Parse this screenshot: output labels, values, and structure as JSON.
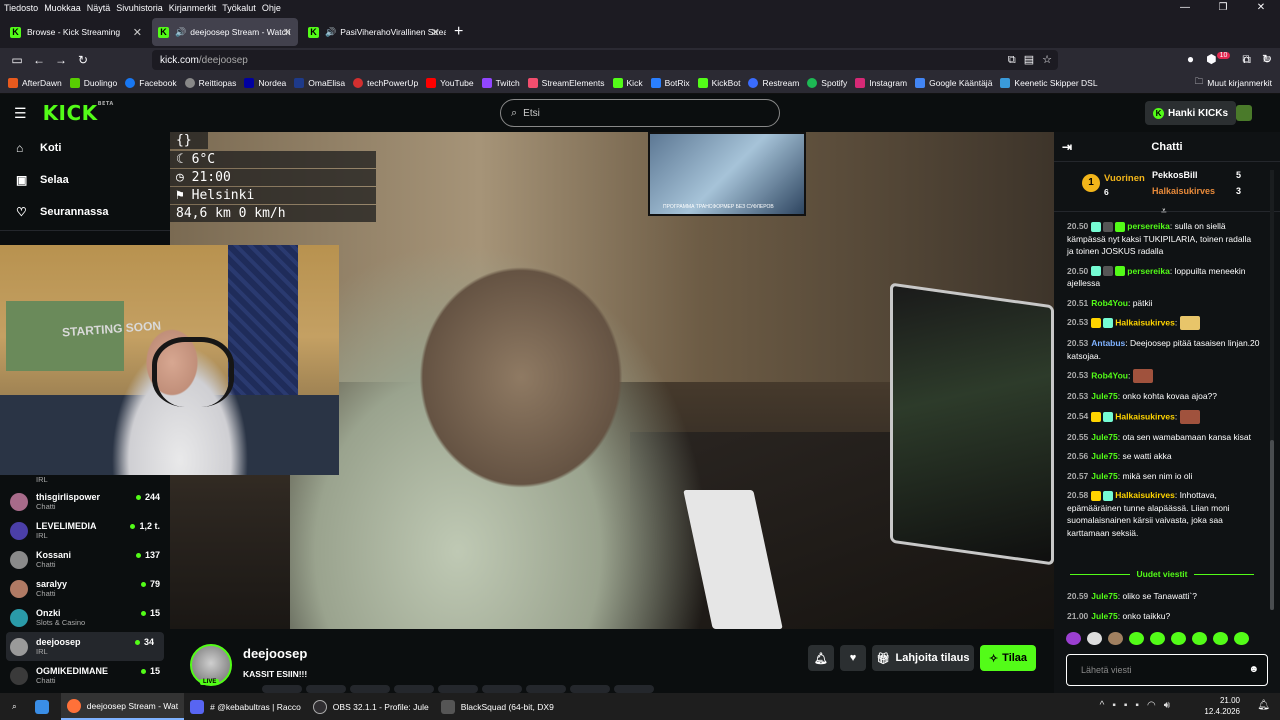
{
  "menubar": [
    "Tiedosto",
    "Muokkaa",
    "Näytä",
    "Sivuhistoria",
    "Kirjanmerkit",
    "Työkalut",
    "Ohje"
  ],
  "tabs": [
    {
      "label": "Browse - Kick Streaming"
    },
    {
      "label": "deejoosep Stream - Watch"
    },
    {
      "label": "PasiViherahoVirallinen Strea"
    }
  ],
  "url": {
    "host": "kick.com",
    "path": "/deejoosep"
  },
  "extension_badge": "10",
  "bookmarks": [
    "AfterDawn",
    "Duolingo",
    "Facebook",
    "Reittiopas",
    "Nordea",
    "OmaElisa",
    "techPowerUp",
    "YouTube",
    "Twitch",
    "StreamElements",
    "Kick",
    "BotRix",
    "KickBot",
    "Restream",
    "Spotify",
    "Instagram",
    "Google Kääntäjä",
    "Keenetic Skipper DSL"
  ],
  "bookmarks_other": "Muut kirjanmerkit",
  "kick": {
    "logo": "KICK",
    "logo_beta": "BETA",
    "search_placeholder": "Etsi",
    "kicks_button": "Hanki KICKs"
  },
  "sidebar": {
    "nav": [
      "Koti",
      "Selaa",
      "Seurannassa"
    ],
    "partial_category": "IRL",
    "channels": [
      {
        "name": "thisgirlispower",
        "category": "Chatti",
        "viewers": "244",
        "color": "#a86b8a"
      },
      {
        "name": "LEVELIMEDIA",
        "category": "IRL",
        "viewers": "1,2 t.",
        "color": "#4b3fa8"
      },
      {
        "name": "Kossani",
        "category": "Chatti",
        "viewers": "137",
        "color": "#8a8a8a"
      },
      {
        "name": "saralyy",
        "category": "Chatti",
        "viewers": "79",
        "color": "#b07a64"
      },
      {
        "name": "Onzki",
        "category": "Slots & Casino",
        "viewers": "15",
        "color": "#2a9aa8"
      },
      {
        "name": "deejoosep",
        "category": "IRL",
        "viewers": "34",
        "color": "#9a9a9a"
      },
      {
        "name": "OGMIKEDIMANE",
        "category": "Chatti",
        "viewers": "15",
        "color": "#3a3a3a"
      }
    ]
  },
  "overlay": {
    "braces": "{}",
    "weather": "6°C",
    "time": "21:00",
    "city": "Helsinki",
    "speed": "84,6 km  0 km/h"
  },
  "webcam_poster": "STARTING SOON",
  "tv_caption": "ПРОГРАММА ТРАНСФОРМЕР БЕЗ СУФЛЕРОВ",
  "stream": {
    "channel": "deejoosep",
    "title": "KASSIT ESIIN!!!",
    "live": "LIVE",
    "gift_label": "Lahjoita tilaus",
    "subscribe_label": "Tilaa"
  },
  "chat": {
    "title": "Chatti",
    "leaderboard": {
      "title": "Vuorinen",
      "rank": "1",
      "first_count": "6",
      "entries": [
        {
          "name": "PekkosBill",
          "count": "5"
        },
        {
          "name": "Halkaisukirves",
          "count": "3"
        }
      ]
    },
    "messages": [
      {
        "time": "20.50",
        "user": "persereika",
        "color": "green",
        "text": "sulla on siellä kämpässä nyt kaksi TUKIPILARIA, toinen radalla ja toinen JOSKUS radalla"
      },
      {
        "time": "20.50",
        "user": "persereika",
        "color": "green",
        "text": "loppuilta meneekin ajellessa"
      },
      {
        "time": "20.51",
        "user": "Rob4You",
        "color": "green",
        "text": "pätkii"
      },
      {
        "time": "20.53",
        "user": "Halkaisukirves",
        "color": "yel",
        "text": ""
      },
      {
        "time": "20.53",
        "user": "Antabus",
        "color": "blue",
        "text": "Deejoosep pitää tasaisen linjan.20 katsojaa."
      },
      {
        "time": "20.53",
        "user": "Rob4You",
        "color": "green",
        "text": ""
      },
      {
        "time": "20.53",
        "user": "Jule75",
        "color": "green",
        "text": "onko kohta kovaa ajoa??"
      },
      {
        "time": "20.54",
        "user": "Halkaisukirves",
        "color": "yel",
        "text": ""
      },
      {
        "time": "20.55",
        "user": "Jule75",
        "color": "green",
        "text": "ota sen wamabamaan kansa kisat"
      },
      {
        "time": "20.56",
        "user": "Jule75",
        "color": "green",
        "text": "se watti akka"
      },
      {
        "time": "20.57",
        "user": "Jule75",
        "color": "green",
        "text": "mikä sen nim io oli"
      },
      {
        "time": "20.58",
        "user": "Halkaisukirves",
        "color": "yel",
        "text": "Inhottava, epämääräinen tunne alapäässä. Liian moni suomalaisnainen kärsii vaivasta, joka saa karttamaan seksiä."
      }
    ],
    "new_messages_label": "Uudet viestit",
    "new_messages": [
      {
        "time": "20.59",
        "user": "Jule75",
        "color": "green",
        "text": "oliko se Tanawatti`?"
      },
      {
        "time": "21.00",
        "user": "Jule75",
        "color": "green",
        "text": "onko taikku?"
      }
    ],
    "input_placeholder": "Lähetä viesti"
  },
  "taskbar": {
    "items": [
      "deejoosep Stream - Wat",
      "# @kebabultras | Racco",
      "OBS 32.1.1 - Profile: Jule",
      "BlackSquad (64-bit, DX9"
    ],
    "time": "21.00",
    "date": "12.4.2026"
  }
}
